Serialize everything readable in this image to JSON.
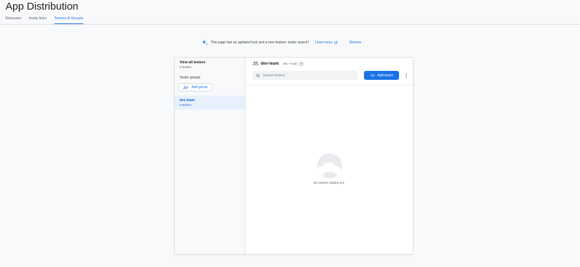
{
  "header": {
    "title": "App Distribution",
    "tabs": [
      {
        "label": "Releases",
        "active": false
      },
      {
        "label": "Invite links",
        "active": false
      },
      {
        "label": "Testers & Groups",
        "active": true
      }
    ]
  },
  "banner": {
    "text": "This page has an updated look and a new feature: tester search!",
    "learn_more": "Learn more",
    "dismiss": "Dismiss"
  },
  "sidebar": {
    "view_all": {
      "title": "View all testers",
      "count": "0 testers"
    },
    "groups_label": "Tester groups",
    "add_group": "Add group",
    "groups": [
      {
        "name": "dev-team",
        "count": "0 testers",
        "selected": true
      }
    ]
  },
  "group_detail": {
    "name": "dev-team",
    "alias": "dev-team",
    "search_placeholder": "Search testers",
    "add_tester": "Add tester",
    "empty_message": "No testers added yet."
  },
  "colors": {
    "accent": "#1a73e8",
    "selected_bg": "#e8f0fe",
    "page_bg": "#f8f9fa"
  },
  "icons": [
    "sparkle-icon",
    "external-link-icon",
    "people-icon",
    "help-circle-icon",
    "search-icon",
    "add-person-icon",
    "more-vert-icon",
    "cloud-illustration"
  ]
}
